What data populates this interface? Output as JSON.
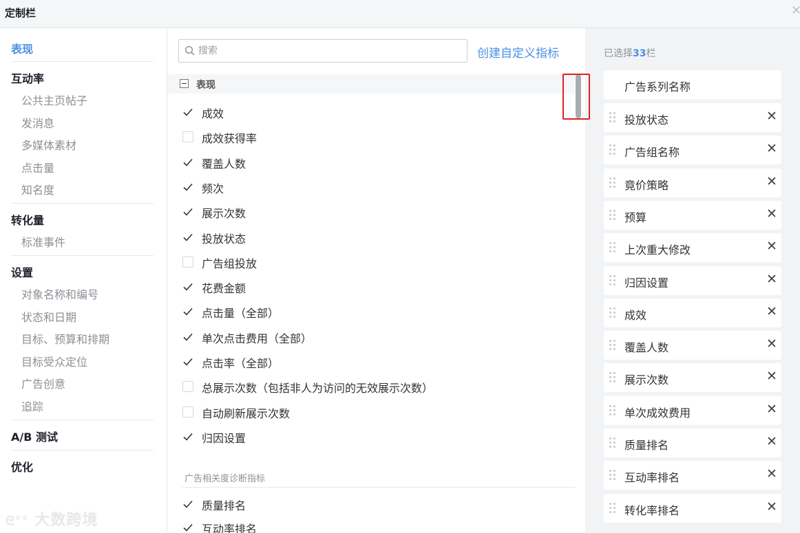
{
  "dialog": {
    "title": "定制栏",
    "close": "×"
  },
  "leftnav": {
    "sections": [
      {
        "label": "表现",
        "active": true,
        "items": []
      },
      {
        "label": "互动率",
        "items": [
          "公共主页帖子",
          "发消息",
          "多媒体素材",
          "点击量",
          "知名度"
        ]
      },
      {
        "label": "转化量",
        "items": [
          "标准事件"
        ]
      },
      {
        "label": "设置",
        "items": [
          "对象名称和编号",
          "状态和日期",
          "目标、预算和排期",
          "目标受众定位",
          "广告创意",
          "追踪"
        ]
      },
      {
        "label": "A/B 测试",
        "items": []
      },
      {
        "label": "优化",
        "items": []
      }
    ]
  },
  "middle": {
    "search_placeholder": "搜索",
    "create_link": "创建自定义指标",
    "group_label": "表现",
    "metrics": [
      {
        "label": "成效",
        "checked": true
      },
      {
        "label": "成效获得率",
        "checked": false
      },
      {
        "label": "覆盖人数",
        "checked": true
      },
      {
        "label": "频次",
        "checked": true
      },
      {
        "label": "展示次数",
        "checked": true
      },
      {
        "label": "投放状态",
        "checked": true
      },
      {
        "label": "广告组投放",
        "checked": false
      },
      {
        "label": "花费金额",
        "checked": true
      },
      {
        "label": "点击量（全部）",
        "checked": true
      },
      {
        "label": "单次点击费用（全部）",
        "checked": true
      },
      {
        "label": "点击率（全部）",
        "checked": true
      },
      {
        "label": "总展示次数（包括非人为访问的无效展示次数）",
        "checked": false
      },
      {
        "label": "自动刷新展示次数",
        "checked": false
      },
      {
        "label": "归因设置",
        "checked": true
      }
    ],
    "sub_group_label": "广告相关度诊断指标",
    "sub_metrics": [
      {
        "label": "质量排名",
        "checked": true
      },
      {
        "label": "互动率排名",
        "checked": true
      }
    ]
  },
  "right": {
    "selected_prefix": "已选择",
    "selected_count": "33",
    "selected_suffix": "栏",
    "fixed_chip": "广告系列名称",
    "chips": [
      "投放状态",
      "广告组名称",
      "竟价策略",
      "预算",
      "上次重大修改",
      "归因设置",
      "成效",
      "覆盖人数",
      "展示次数",
      "单次成效费用",
      "质量排名",
      "互动率排名",
      "转化率排名"
    ],
    "remove_glyph": "✕"
  },
  "watermark": {
    "text": "大数跨境"
  },
  "colors": {
    "accent": "#4a90e2",
    "highlight": "#e02020",
    "panel_bg": "#f2f3f5"
  }
}
